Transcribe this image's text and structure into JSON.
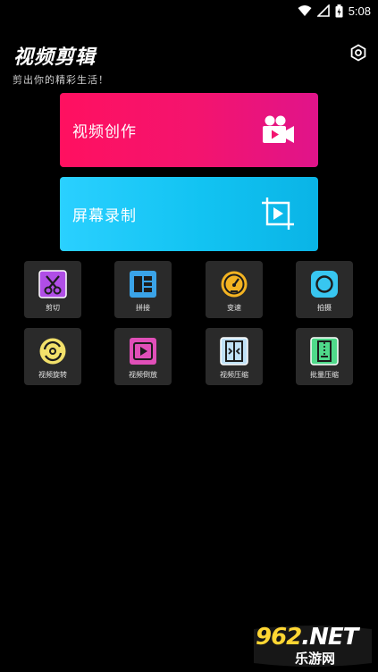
{
  "status_bar": {
    "time": "5:08"
  },
  "header": {
    "title": "视频剪辑",
    "subtitle": "剪出你的精彩生活！"
  },
  "cards": {
    "video_create": {
      "label": "视频创作",
      "icon": "movie-camera-icon"
    },
    "screen_record": {
      "label": "屏幕录制",
      "icon": "screen-record-icon"
    }
  },
  "tools": [
    {
      "label": "剪切",
      "icon": "scissors-icon"
    },
    {
      "label": "拼接",
      "icon": "splice-icon"
    },
    {
      "label": "变速",
      "icon": "speedometer-icon"
    },
    {
      "label": "拍摄",
      "icon": "camera-shoot-icon"
    },
    {
      "label": "视频旋转",
      "icon": "rotate-icon"
    },
    {
      "label": "视频倒放",
      "icon": "reverse-play-icon"
    },
    {
      "label": "视频压缩",
      "icon": "compress-icon"
    },
    {
      "label": "批量压缩",
      "icon": "batch-compress-icon"
    }
  ],
  "watermark": {
    "big": "962.NET",
    "small": "乐游网"
  },
  "colors": {
    "background": "#000000",
    "video_card": "#f3146f",
    "record_card": "#12c3f2",
    "tool_tile": "#2a2a2a"
  }
}
